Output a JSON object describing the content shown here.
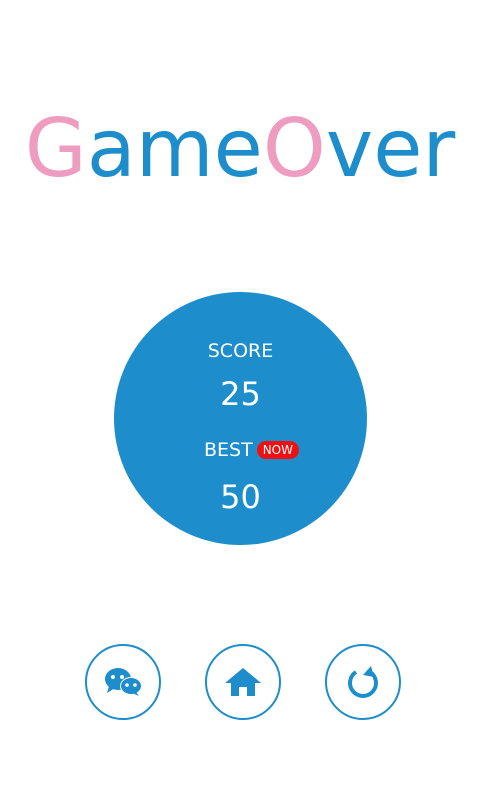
{
  "title": {
    "letters": [
      {
        "text": "G",
        "color": "#ee9dc0"
      },
      {
        "text": "ame",
        "color": "#1d8dcb"
      },
      {
        "text": "O",
        "color": "#ee9dc0"
      },
      {
        "text": "ver",
        "color": "#1d8dcb"
      }
    ]
  },
  "score": {
    "label": "SCORE",
    "value": "25"
  },
  "best": {
    "label": "BEST",
    "badge": "NOW",
    "value": "50"
  },
  "buttons": {
    "share_icon": "wechat-icon",
    "home_icon": "home-icon",
    "restart_icon": "restart-icon"
  },
  "colors": {
    "primary": "#1d8dcb",
    "accent_pink": "#ee9dc0",
    "badge_red": "#ee1111",
    "background": "#ffffff"
  }
}
